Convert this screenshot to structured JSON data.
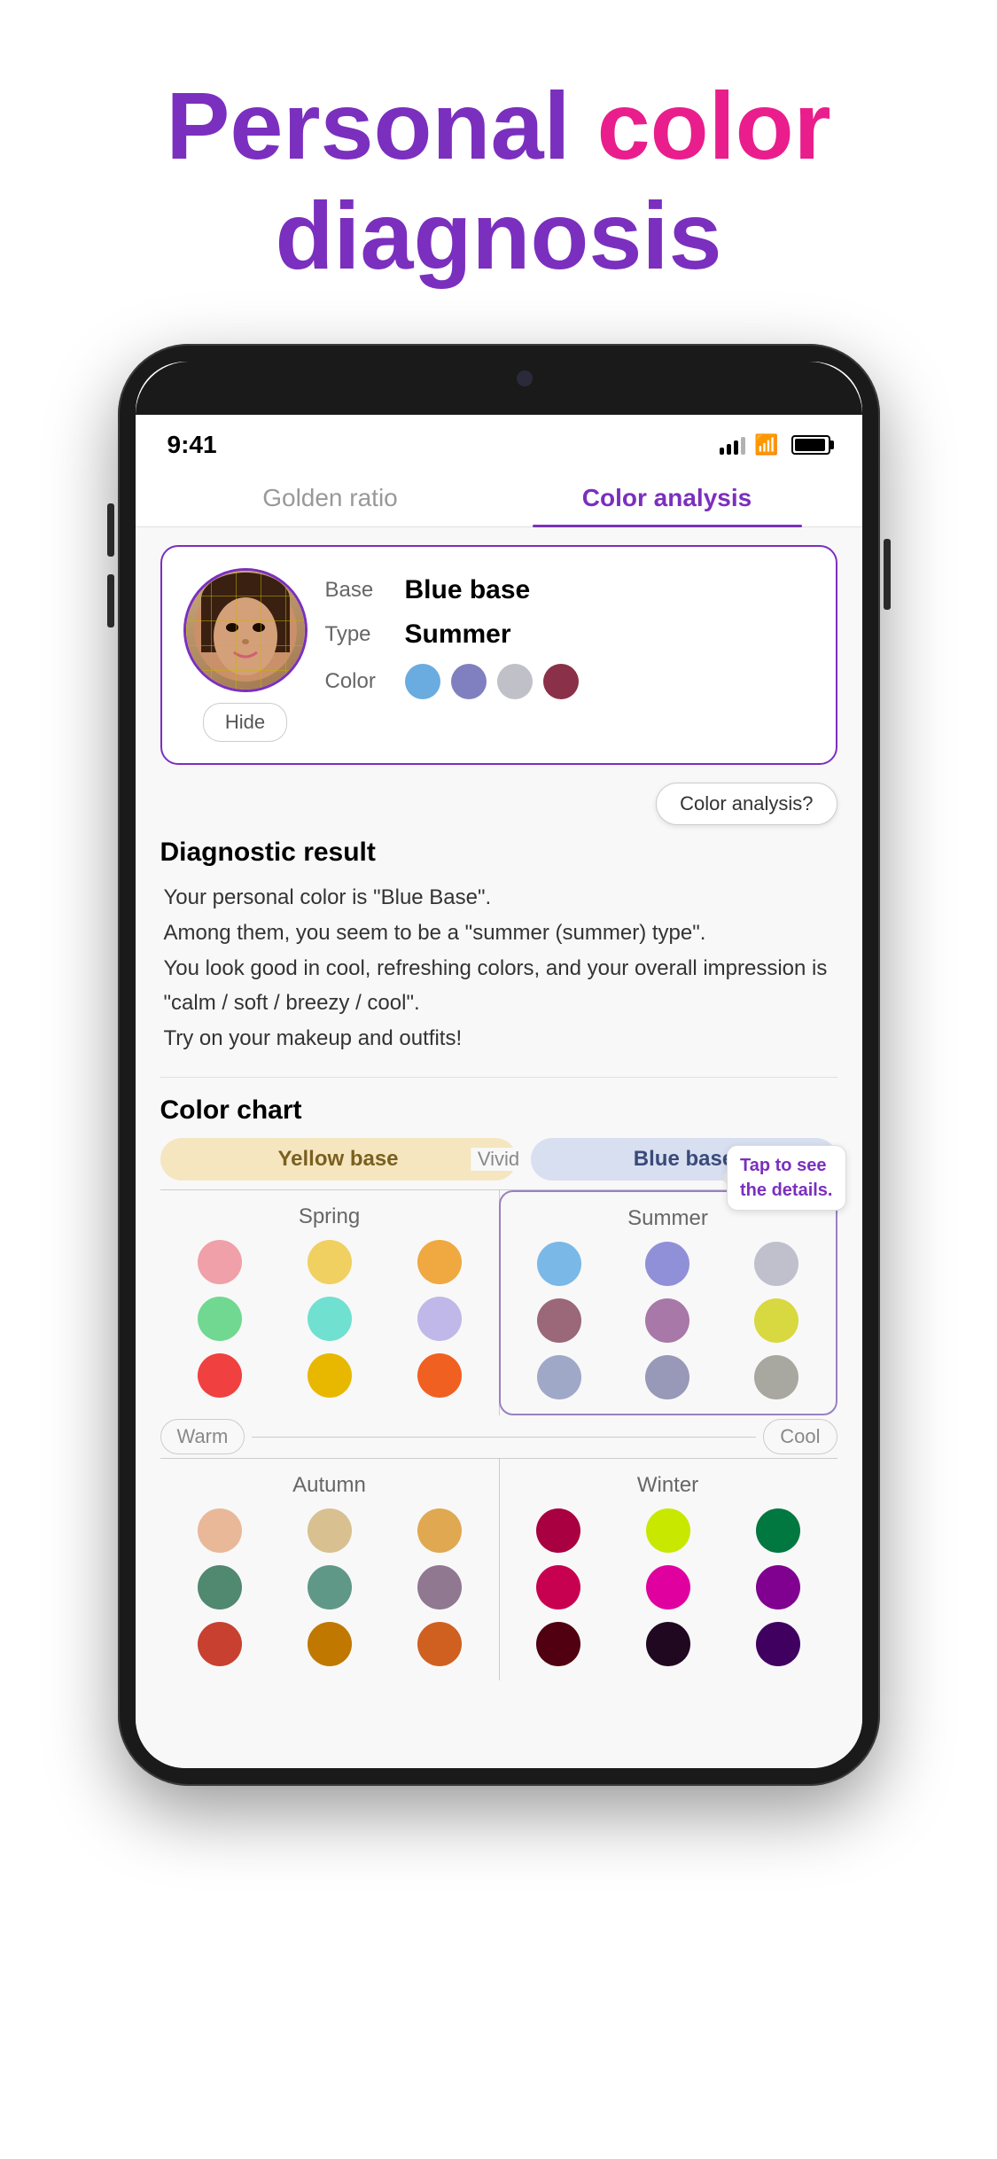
{
  "title": {
    "line1_personal": "Personal",
    "line1_color": " color",
    "line2": "diagnosis"
  },
  "status_bar": {
    "time": "9:41",
    "signal": "signal",
    "wifi": "wifi",
    "battery": "battery"
  },
  "tabs": [
    {
      "id": "golden-ratio",
      "label": "Golden ratio",
      "active": false
    },
    {
      "id": "color-analysis",
      "label": "Color analysis",
      "active": true
    }
  ],
  "result_card": {
    "base_label": "Base",
    "base_value": "Blue base",
    "type_label": "Type",
    "type_value": "Summer",
    "color_label": "Color",
    "colors": [
      {
        "hex": "#6aacdf",
        "name": "light-blue"
      },
      {
        "hex": "#8080c0",
        "name": "medium-purple-blue"
      },
      {
        "hex": "#c0c0c8",
        "name": "light-gray"
      },
      {
        "hex": "#8a3048",
        "name": "dark-rose"
      }
    ],
    "hide_button": "Hide"
  },
  "color_analysis_button": "Color analysis?",
  "diagnostic": {
    "title": "Diagnostic result",
    "text": "Your personal color is \"Blue Base\".\nAmong them, you seem to be a \"summer (summer) type\".\nYou look good in cool, refreshing colors, and your overall impression is \"calm / soft / breezy / cool\".\nTry on your makeup and outfits!"
  },
  "color_chart": {
    "title": "Color chart",
    "yellow_base_label": "Yellow base",
    "blue_base_label": "Blue base",
    "vivid_label": "Vivid",
    "warm_label": "Warm",
    "cool_label": "Cool",
    "tap_tooltip": "Tap to see\nthe details.",
    "seasons": {
      "spring": {
        "name": "Spring",
        "colors": [
          "#f0a0a8",
          "#f0d060",
          "#f0a840",
          "#70d890",
          "#70e0d0",
          "#c0b8e8",
          "#f04040",
          "#e8b800",
          "#f06020"
        ]
      },
      "summer": {
        "name": "Summer",
        "colors": [
          "#7ab8e8",
          "#9090d8",
          "#c0c0cc",
          "#9a6878",
          "#a878a8",
          "#d8d840",
          "#a0a8c8",
          "#9898b8",
          "#a8a8a0"
        ]
      },
      "autumn": {
        "name": "Autumn",
        "colors": [
          "#e8b898",
          "#d8c090",
          "#e0a850",
          "#508870",
          "#609888",
          "#907890",
          "#c84030",
          "#c07800",
          "#d06020"
        ]
      },
      "winter": {
        "name": "Winter",
        "colors": [
          "#a80040",
          "#c8e800",
          "#007840",
          "#c80050",
          "#e000a0",
          "#800090",
          "#500010",
          "#200820",
          "#400060"
        ]
      }
    }
  }
}
